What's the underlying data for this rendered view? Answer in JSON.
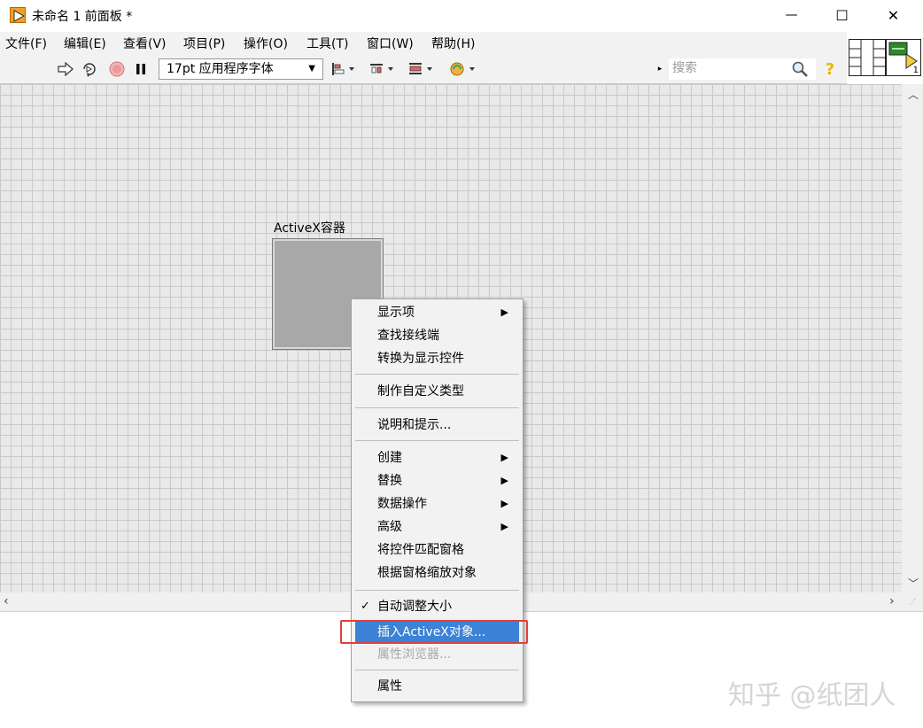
{
  "window": {
    "title": "未命名 1 前面板 *",
    "controls": {
      "minimize": "—",
      "maximize": "☐",
      "close": "✕"
    }
  },
  "menu": {
    "items": [
      "文件(F)",
      "编辑(E)",
      "查看(V)",
      "项目(P)",
      "操作(O)",
      "工具(T)",
      "窗口(W)",
      "帮助(H)"
    ]
  },
  "toolbar": {
    "font_selector": "17pt 应用程序字体",
    "search_placeholder": "搜索",
    "connector_count": "1"
  },
  "canvas": {
    "control_label": "ActiveX容器"
  },
  "context_menu": {
    "items": [
      {
        "label": "显示项",
        "submenu": true
      },
      {
        "label": "查找接线端"
      },
      {
        "label": "转换为显示控件"
      },
      {
        "label": "制作自定义类型"
      },
      {
        "label": "说明和提示..."
      },
      {
        "label": "创建",
        "submenu": true
      },
      {
        "label": "替换",
        "submenu": true
      },
      {
        "label": "数据操作",
        "submenu": true
      },
      {
        "label": "高级",
        "submenu": true
      },
      {
        "label": "将控件匹配窗格"
      },
      {
        "label": "根据窗格缩放对象"
      },
      {
        "label": "自动调整大小",
        "checked": true
      },
      {
        "label": "插入ActiveX对象...",
        "highlighted": true
      },
      {
        "label": "属性浏览器...",
        "disabled": true
      },
      {
        "label": "属性"
      }
    ]
  },
  "watermark": "知乎 @纸团人",
  "colors": {
    "highlight": "#3c82d6",
    "annotation_box": "#e0413c",
    "grid_bg": "#e9e9e9",
    "run_button": "#f0a020"
  }
}
